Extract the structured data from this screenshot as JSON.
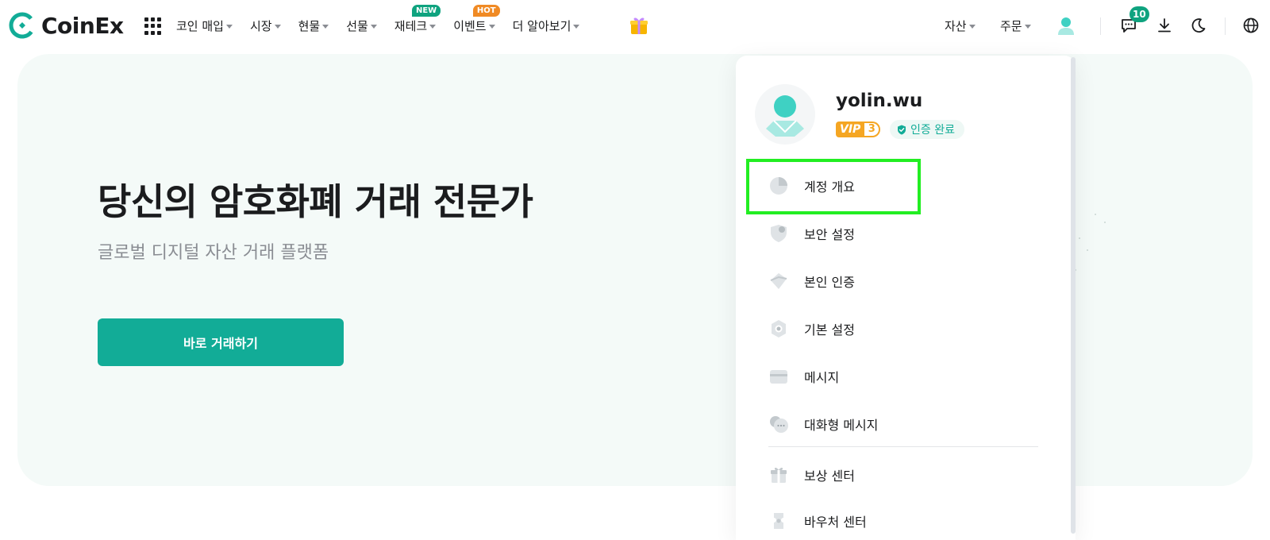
{
  "brand": {
    "name": "CoinEx"
  },
  "nav": {
    "items": [
      {
        "label": "코인 매입",
        "badge": ""
      },
      {
        "label": "시장",
        "badge": ""
      },
      {
        "label": "현물",
        "badge": ""
      },
      {
        "label": "선물",
        "badge": ""
      },
      {
        "label": "재테크",
        "badge": "NEW"
      },
      {
        "label": "이벤트",
        "badge": "HOT"
      },
      {
        "label": "더 알아보기",
        "badge": ""
      }
    ]
  },
  "right_nav": {
    "assets_label": "자산",
    "orders_label": "주문",
    "message_count": "10"
  },
  "hero": {
    "title": "당신의 암호화폐 거래 전문가",
    "subtitle": "글로벌 디지털 자산 거래 플랫폼",
    "cta_label": "바로 거래하기"
  },
  "account_menu": {
    "username": "yolin.wu",
    "vip_label": "VIP",
    "vip_level": "3",
    "verified_label": "인증 완료",
    "items": [
      {
        "label": "계정 개요",
        "icon": "pie-chart-icon"
      },
      {
        "label": "보안 설정",
        "icon": "shield-icon"
      },
      {
        "label": "본인 인증",
        "icon": "id-verify-icon"
      },
      {
        "label": "기본 설정",
        "icon": "settings-icon"
      },
      {
        "label": "메시지",
        "icon": "message-icon"
      },
      {
        "label": "대화형 메시지",
        "icon": "chat-icon"
      },
      {
        "label": "보상 센터",
        "icon": "gift-icon"
      },
      {
        "label": "바우처 센터",
        "icon": "voucher-icon"
      }
    ]
  },
  "colors": {
    "brand": "#12ac97",
    "highlight": "#22ee22",
    "new_badge": "#0fa37f",
    "hot_badge": "#f08a24",
    "vip": "#f5a623"
  }
}
